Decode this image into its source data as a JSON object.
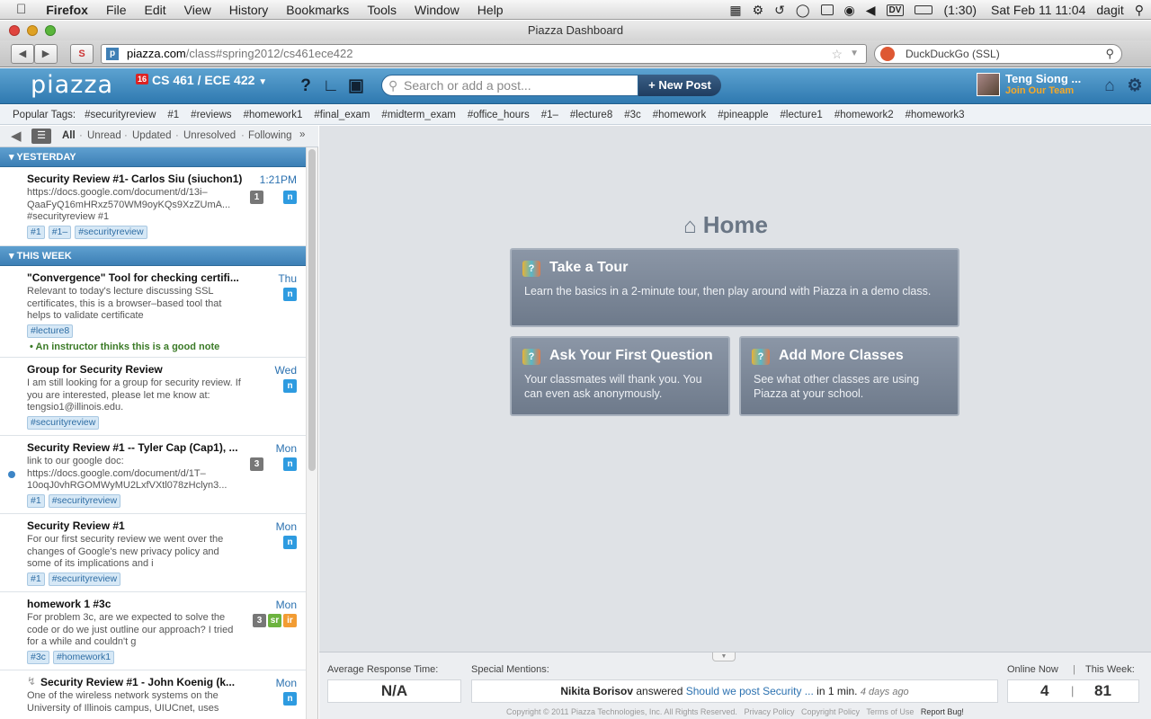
{
  "menubar": {
    "app": "Firefox",
    "items": [
      "File",
      "Edit",
      "View",
      "History",
      "Bookmarks",
      "Tools",
      "Window",
      "Help"
    ],
    "battery": "(1:30)",
    "datetime": "Sat Feb 11  11:04",
    "user": "dagit",
    "input_source": "DV"
  },
  "window": {
    "title": "Piazza Dashboard"
  },
  "navbar": {
    "url_host": "piazza.com",
    "url_path": "/class#spring2012/cs461ece422",
    "search_engine": "DuckDuckGo (SSL)"
  },
  "header": {
    "logo": "piazza",
    "class_badge": "16",
    "class_name": "CS 461 / ECE 422",
    "search_placeholder": "Search or add a post...",
    "new_post": "+ New Post",
    "user_name": "Teng Siong ...",
    "join_link": "Join Our Team"
  },
  "tagbar": {
    "label": "Popular Tags:",
    "tags": [
      "#securityreview",
      "#1",
      "#reviews",
      "#homework1",
      "#final_exam",
      "#midterm_exam",
      "#office_hours",
      "#1–",
      "#lecture8",
      "#3c",
      "#homework",
      "#pineapple",
      "#lecture1",
      "#homework2",
      "#homework3"
    ]
  },
  "filters": {
    "all": "All",
    "unread": "Unread",
    "updated": "Updated",
    "unresolved": "Unresolved",
    "following": "Following",
    "more": "»"
  },
  "feed": {
    "groups": [
      {
        "label": "YESTERDAY"
      },
      {
        "label": "THIS WEEK"
      }
    ],
    "posts": [
      {
        "title": "Security Review #1- Carlos Siu (siuchon1)",
        "snippet": "https://docs.google.com/document/d/13i–QaaFyQ16mHRxz570WM9oyKQs9XzZUmA... #securityreview #1",
        "when": "1:21PM",
        "count": "1",
        "new": "n",
        "tags": [
          "#1",
          "#1–",
          "#securityreview"
        ]
      },
      {
        "title": "\"Convergence\" Tool for checking certifi...",
        "snippet": "Relevant to today's lecture discussing SSL certificates, this is a browser–based tool that helps to validate certificate",
        "when": "Thu",
        "new": "n",
        "tags": [
          "#lecture8"
        ],
        "note": "An instructor thinks this is a good note"
      },
      {
        "title": "Group for Security Review",
        "snippet": "I am still looking for a group for security review. If you are interested, please let me know at: tengsio1@illinois.edu.",
        "when": "Wed",
        "new": "n",
        "tags": [
          "#securityreview"
        ]
      },
      {
        "title": "Security Review #1 -- Tyler Cap (Cap1), ...",
        "snippet": "link to our google doc: https://docs.google.com/document/d/1T–10oqJ0vhRGOMWyMU2LxfVXtl078zHclyn3...",
        "when": "Mon",
        "count": "3",
        "new": "n",
        "tags": [
          "#1",
          "#securityreview"
        ]
      },
      {
        "title": "Security Review #1",
        "snippet": "For our first security review we went over the changes of Google's new privacy policy and some of its implications and i",
        "when": "Mon",
        "new": "n",
        "tags": [
          "#1",
          "#securityreview"
        ]
      },
      {
        "title": "homework 1 #3c",
        "snippet": "For problem 3c, are we expected to solve the code or do we just outline our approach? I tried for a while and couldn't g",
        "when": "Mon",
        "count": "3",
        "sr": "sr",
        "ir": "ir",
        "tags": [
          "#3c",
          "#homework1"
        ]
      },
      {
        "title": "Security Review #1 - John Koenig (k...",
        "snippet": "One of the wireless network systems on the University of Illinois campus, UIUCnet, uses",
        "when": "Mon",
        "new": "n"
      }
    ]
  },
  "home": {
    "title": "Home",
    "cards": [
      {
        "title": "Take a Tour",
        "desc": "Learn the basics in a 2-minute tour, then play around with Piazza in a demo class."
      },
      {
        "title": "Ask Your First Question",
        "desc": "Your classmates will thank you. You can even ask anonymously."
      },
      {
        "title": "Add More Classes",
        "desc": "See what other classes are using Piazza at your school."
      }
    ]
  },
  "stats": {
    "avg_label": "Average Response Time:",
    "avg_value": "N/A",
    "mentions_label": "Special Mentions:",
    "mention_user": "Nikita Borisov",
    "mention_verb": "answered",
    "mention_link": "Should we post Security ...",
    "mention_in": "in 1 min.",
    "mention_ago": "4 days ago",
    "online_label": "Online Now",
    "week_label": "This Week:",
    "online_value": "4",
    "week_value": "81",
    "sep": "|",
    "copyright": "Copyright © 2011 Piazza Technologies, Inc. All Rights Reserved.",
    "privacy": "Privacy Policy",
    "copyright_policy": "Copyright Policy",
    "terms": "Terms of Use",
    "report": "Report Bug!"
  }
}
